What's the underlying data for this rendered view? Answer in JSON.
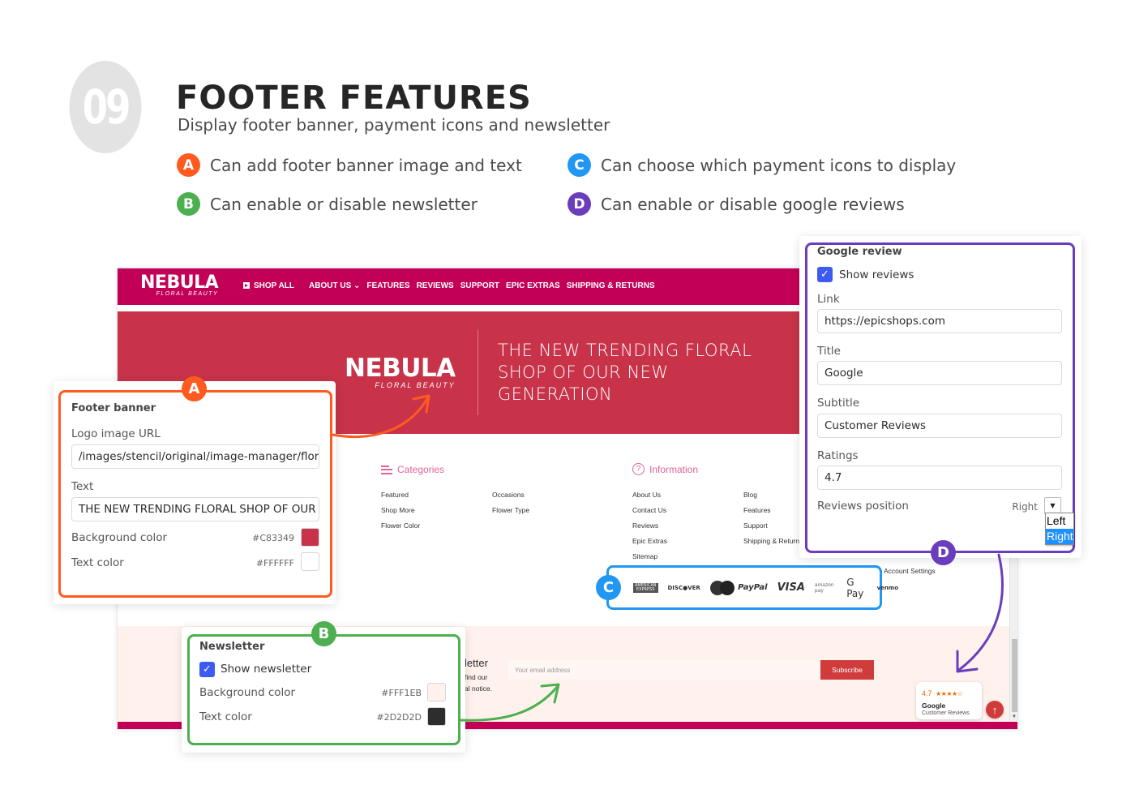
{
  "header": {
    "step_number": "09",
    "title": "FOOTER FEATURES",
    "subtitle": "Display footer banner, payment icons and newsletter",
    "features": [
      {
        "badge": "A",
        "text": "Can add footer banner image and text",
        "color": "#FF5A1F"
      },
      {
        "badge": "B",
        "text": "Can enable or disable newsletter",
        "color": "#4CAF50"
      },
      {
        "badge": "C",
        "text": "Can choose which payment icons to display",
        "color": "#2196F3"
      },
      {
        "badge": "D",
        "text": "Can enable or disable google reviews",
        "color": "#6A3DBD"
      }
    ]
  },
  "site": {
    "brand": {
      "name": "NEBULA",
      "tagline": "FLORAL BEAUTY"
    },
    "nav": [
      "SHOP ALL",
      "ABOUT US",
      "FEATURES",
      "REVIEWS",
      "SUPPORT",
      "EPIC EXTRAS",
      "SHIPPING & RETURNS"
    ],
    "nav_colors": {
      "bar": "#C30058"
    },
    "banner": {
      "logo_name": "NEBULA",
      "logo_tagline": "FLORAL BEAUTY",
      "text": "THE NEW TRENDING FLORAL SHOP OF OUR NEW GENERATION",
      "background": "#C83349"
    },
    "categories": {
      "heading": "Categories",
      "col1": [
        "Featured",
        "Shop More",
        "Flower Color"
      ],
      "col2": [
        "Occasions",
        "Flower Type"
      ]
    },
    "information": {
      "heading": "Information",
      "col1": [
        "About Us",
        "Contact Us",
        "Reviews",
        "Epic Extras",
        "Sitemap"
      ],
      "col2": [
        "Blog",
        "Features",
        "Support",
        "Shipping & Returns"
      ]
    },
    "account_settings": "Account Settings",
    "payment_icons": [
      "American Express",
      "Discover",
      "MasterCard",
      "PayPal",
      "VISA",
      "amazon pay",
      "G Pay",
      "venmo"
    ],
    "newsletter": {
      "title_fragment": "letter",
      "desc_line1": "find our",
      "desc_line2": "al notice.",
      "email_placeholder": "Your email address",
      "subscribe_label": "Subscribe"
    },
    "google_review_widget": {
      "rating": "4.7",
      "stars": "★★★★☆",
      "title": "Google",
      "subtitle": "Customer Reviews"
    },
    "back_to_top": "↑"
  },
  "panel_a": {
    "badge": "A",
    "title": "Footer banner",
    "logo_label": "Logo image URL",
    "logo_value": "/images/stencil/original/image-manager/flora",
    "text_label": "Text",
    "text_value": "THE NEW TRENDING FLORAL SHOP OF OUR NEW GENERATION",
    "bg_label": "Background color",
    "bg_value": "#C83349",
    "text_color_label": "Text color",
    "text_color_value": "#FFFFFF"
  },
  "panel_b": {
    "badge": "B",
    "title": "Newsletter",
    "show_label": "Show newsletter",
    "show_checked": true,
    "bg_label": "Background color",
    "bg_value": "#FFF1EB",
    "text_color_label": "Text color",
    "text_color_value": "#2D2D2D"
  },
  "panel_c": {
    "badge": "C"
  },
  "panel_d": {
    "badge": "D",
    "title": "Google review",
    "show_label": "Show reviews",
    "show_checked": true,
    "link_label": "Link",
    "link_value": "https://epicshops.com",
    "title_label": "Title",
    "title_value": "Google",
    "subtitle_label": "Subtitle",
    "subtitle_value": "Customer Reviews",
    "ratings_label": "Ratings",
    "ratings_value": "4.7",
    "position_label": "Reviews position",
    "position_value": "Right",
    "position_options": [
      "Left",
      "Right"
    ]
  }
}
